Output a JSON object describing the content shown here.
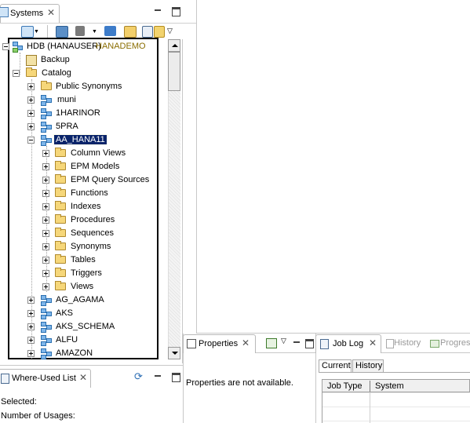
{
  "systems_view": {
    "tab_title": "Systems",
    "tree": {
      "root": {
        "label": "HDB (HANAUSER)",
        "suffix": "HANADEMO"
      },
      "backup": "Backup",
      "catalog": "Catalog",
      "schemas_before": [
        "Public Synonyms",
        "muni",
        "1HARINOR",
        "5PRA"
      ],
      "selected_schema": "AA_HANA11",
      "selected_children": [
        "Column Views",
        "EPM Models",
        "EPM Query Sources",
        "Functions",
        "Indexes",
        "Procedures",
        "Sequences",
        "Synonyms",
        "Tables",
        "Triggers",
        "Views"
      ],
      "schemas_after": [
        "AG_AGAMA",
        "AKS",
        "AKS_SCHEMA",
        "ALFU",
        "AMAZON"
      ]
    }
  },
  "where_used": {
    "tab_title": "Where-Used List",
    "selected_label": "Selected:",
    "usages_label": "Number of Usages:"
  },
  "properties": {
    "tab_title": "Properties",
    "message": "Properties are not available."
  },
  "job_log": {
    "tab_title": "Job Log",
    "history_tab": "History",
    "progress_tab": "Progress",
    "subtabs": [
      "Current",
      "History"
    ],
    "columns": [
      "Job Type",
      "System"
    ]
  },
  "colors": {
    "selection": "#0a246a",
    "system_suffix": "#8a6d00",
    "folder": "#f6d77a"
  }
}
